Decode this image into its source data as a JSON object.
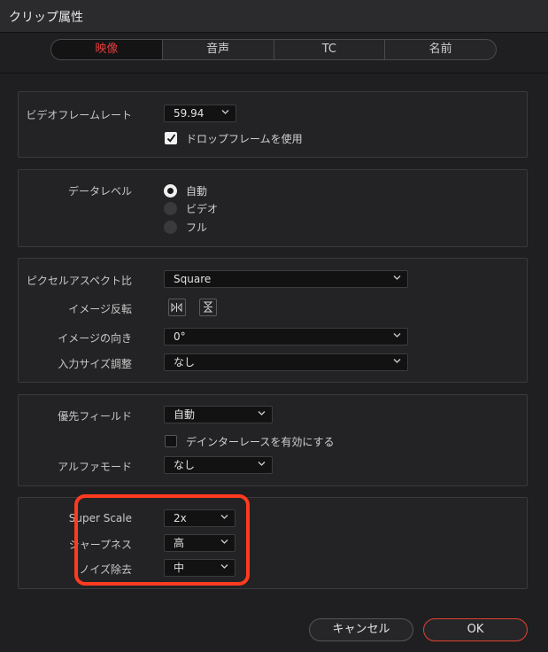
{
  "window": {
    "title": "クリップ属性"
  },
  "tabs": [
    {
      "label": "映像",
      "active": true
    },
    {
      "label": "音声",
      "active": false
    },
    {
      "label": "TC",
      "active": false
    },
    {
      "label": "名前",
      "active": false
    }
  ],
  "video_frame": {
    "framerate_label": "ビデオフレームレート",
    "framerate_value": "59.94",
    "dropframe_label": "ドロップフレームを使用",
    "dropframe_checked": true
  },
  "data_level": {
    "label": "データレベル",
    "options": [
      "自動",
      "ビデオ",
      "フル"
    ],
    "selected": "自動"
  },
  "pixel": {
    "aspect_label": "ピクセルアスペクト比",
    "aspect_value": "Square",
    "flip_label": "イメージ反転",
    "orientation_label": "イメージの向き",
    "orientation_value": "0°",
    "scaling_label": "入力サイズ調整",
    "scaling_value": "なし"
  },
  "field": {
    "dominance_label": "優先フィールド",
    "dominance_value": "自動",
    "deinterlace_label": "デインターレースを有効にする",
    "deinterlace_checked": false,
    "alpha_label": "アルファモード",
    "alpha_value": "なし"
  },
  "super_scale": {
    "label": "Super Scale",
    "value": "2x",
    "sharpness_label": "シャープネス",
    "sharpness_value": "高",
    "noise_label": "ノイズ除去",
    "noise_value": "中"
  },
  "buttons": {
    "cancel": "キャンセル",
    "ok": "OK"
  },
  "colors": {
    "accent": "#e43b3b",
    "highlight": "#ff3b1f",
    "background": "#1f1f21"
  }
}
